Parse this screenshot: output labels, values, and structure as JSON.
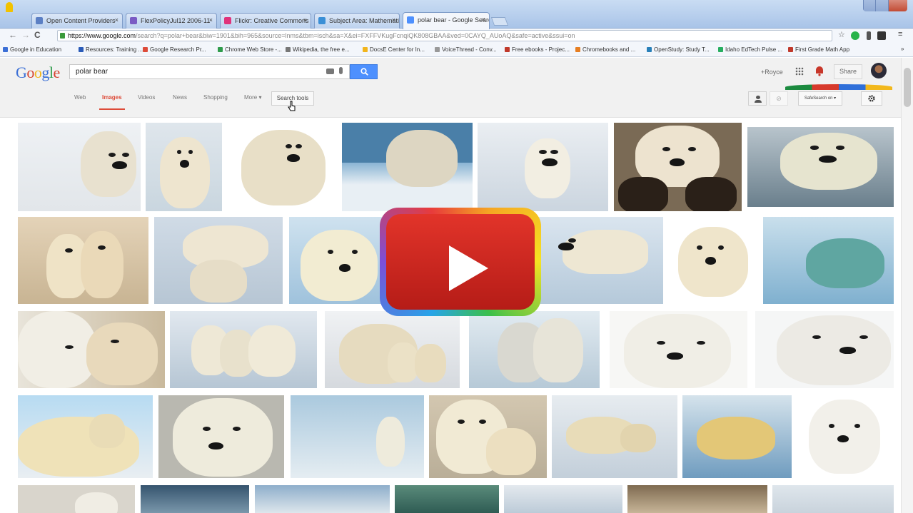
{
  "browser": {
    "tabs": [
      {
        "label": "Open Content Providers",
        "favicon_color": "#5b7fc4"
      },
      {
        "label": "FlexPolicyJul12 2006-11",
        "favicon_color": "#7a5bc4"
      },
      {
        "label": "Flickr: Creative Commons",
        "favicon_color": "#e0337b"
      },
      {
        "label": "Subject Area: Mathemati",
        "favicon_color": "#3a8fd6"
      },
      {
        "label": "polar bear - Google Searc",
        "favicon_color": "#4d90fe"
      }
    ],
    "address_bar": {
      "host": "https://www.google.com",
      "path": "/search?q=polar+bear&biw=1901&bih=965&source=lnms&tbm=isch&sa=X&ei=FXFFVKugFcnqiQK808GBAA&ved=0CAYQ_AUoAQ&safe=active&ssui=on"
    },
    "bookmarks": [
      {
        "label": "Google in Education",
        "color": "#3b6fd6"
      },
      {
        "label": "Resources: Training ...",
        "color": "#2a5bb8"
      },
      {
        "label": "Google Research Pr...",
        "color": "#dd4b39"
      },
      {
        "label": "Chrome Web Store -...",
        "color": "#2f9b4b"
      },
      {
        "label": "Wikipedia, the free e...",
        "color": "#777777"
      },
      {
        "label": "DocsE Center for In...",
        "color": "#f2b51c"
      },
      {
        "label": "VoiceThread - Conv...",
        "color": "#999999"
      },
      {
        "label": "Free ebooks - Projec...",
        "color": "#c0392b"
      },
      {
        "label": "Chromebooks and ...",
        "color": "#e67e22"
      },
      {
        "label": "OpenStudy: Study T...",
        "color": "#2980b9"
      },
      {
        "label": "Idaho EdTech Pulse ...",
        "color": "#27ae60"
      },
      {
        "label": "First Grade Math App",
        "color": "#c0392b"
      }
    ]
  },
  "google": {
    "logo": [
      "G",
      "o",
      "o",
      "g",
      "l",
      "e"
    ],
    "query": "polar bear",
    "user_name": "+Royce",
    "share_label": "Share",
    "nav_tabs": [
      "Web",
      "Images",
      "Videos",
      "News",
      "Shopping",
      "More ▾"
    ],
    "active_tab": "Images",
    "search_tools_label": "Search tools",
    "safesearch_label": "SafeSearch on ▾"
  },
  "overlay": {
    "accent": "#e2342a"
  }
}
